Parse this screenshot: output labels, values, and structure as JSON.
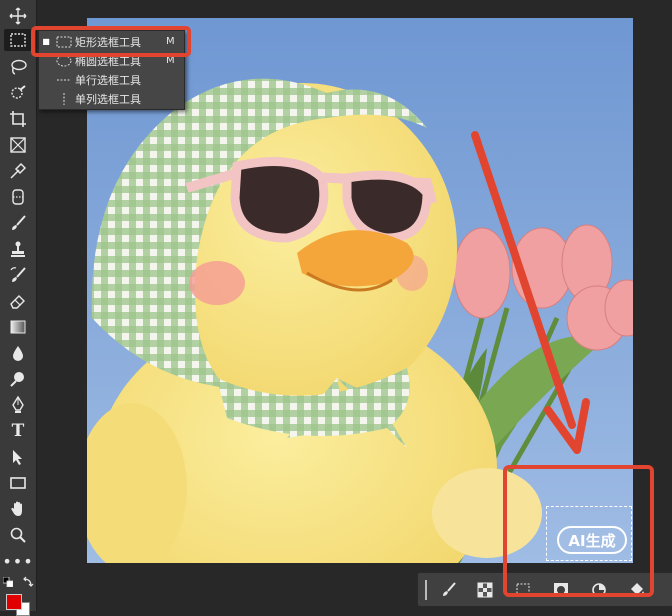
{
  "toolbar": {
    "tools": [
      {
        "name": "move-tool",
        "icon": "move-icon"
      },
      {
        "name": "rectangular-marquee-tool",
        "icon": "marquee-icon",
        "active": true
      },
      {
        "name": "lasso-tool",
        "icon": "lasso-icon"
      },
      {
        "name": "quick-selection-tool",
        "icon": "quick-selection-icon"
      },
      {
        "name": "crop-tool",
        "icon": "crop-icon"
      },
      {
        "name": "frame-tool",
        "icon": "frame-icon"
      },
      {
        "name": "eyedropper-tool",
        "icon": "eyedropper-icon"
      },
      {
        "name": "healing-brush-tool",
        "icon": "bandage-icon"
      },
      {
        "name": "brush-tool",
        "icon": "brush-icon"
      },
      {
        "name": "clone-stamp-tool",
        "icon": "stamp-icon"
      },
      {
        "name": "history-brush-tool",
        "icon": "history-brush-icon"
      },
      {
        "name": "eraser-tool",
        "icon": "eraser-icon"
      },
      {
        "name": "gradient-tool",
        "icon": "gradient-icon"
      },
      {
        "name": "blur-tool",
        "icon": "drop-icon"
      },
      {
        "name": "dodge-tool",
        "icon": "dodge-icon"
      },
      {
        "name": "pen-tool",
        "icon": "pen-icon"
      },
      {
        "name": "type-tool",
        "icon": "type-icon",
        "label": "T"
      },
      {
        "name": "path-selection-tool",
        "icon": "arrow-icon"
      },
      {
        "name": "rectangle-tool",
        "icon": "rectangle-icon"
      },
      {
        "name": "hand-tool",
        "icon": "hand-icon"
      },
      {
        "name": "zoom-tool",
        "icon": "zoom-icon"
      },
      {
        "name": "edit-toolbar",
        "icon": "more-icon",
        "label": "•••"
      }
    ],
    "foreground_color": "#e00000",
    "background_color": "#ffffff"
  },
  "flyout": {
    "items": [
      {
        "label": "矩形选框工具",
        "shortcut": "M",
        "selected": true,
        "icon": "rect-marquee-icon"
      },
      {
        "label": "椭圆选框工具",
        "shortcut": "M",
        "selected": false,
        "icon": "ellipse-marquee-icon"
      },
      {
        "label": "单行选框工具",
        "shortcut": "",
        "selected": false,
        "icon": "single-row-marquee-icon"
      },
      {
        "label": "单列选框工具",
        "shortcut": "",
        "selected": false,
        "icon": "single-column-marquee-icon"
      }
    ]
  },
  "ai_generate": {
    "label": "AI生成"
  },
  "context_bar": {
    "icons": [
      "brush-mask-icon",
      "checker-icon",
      "transform-icon",
      "mask-icon",
      "circle-icon",
      "bucket-icon"
    ]
  },
  "colors": {
    "accent_highlight": "#e2452f",
    "sky": "#7ea3d8"
  }
}
